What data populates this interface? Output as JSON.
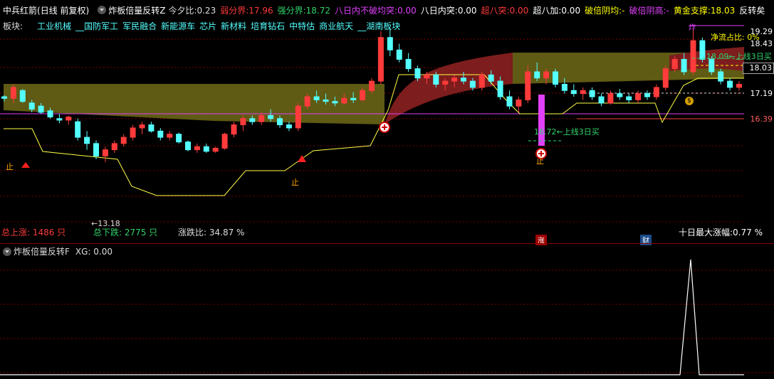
{
  "header": {
    "stock": "中兵红箭",
    "period": "(日线 前复权)",
    "indicator_name": "炸板倍量反转Z",
    "items": [
      {
        "label": "今夕比:",
        "value": "0.23",
        "label_color": "#dddddd",
        "value_color": "#dddddd"
      },
      {
        "label": "弱分界:",
        "value": "17.96",
        "label_color": "#ff3b3b",
        "value_color": "#ff3b3b"
      },
      {
        "label": "强分界:",
        "value": "18.72",
        "label_color": "#31d26a",
        "value_color": "#31d26a"
      },
      {
        "label": "八日内不破均突:",
        "value": "0.00",
        "label_color": "#e040fb",
        "value_color": "#e040fb"
      },
      {
        "label": "八日内突:",
        "value": "0.00",
        "label_color": "#ffffff",
        "value_color": "#ffffff"
      },
      {
        "label": "超八突:",
        "value": "0.00",
        "label_color": "#ff3b3b",
        "value_color": "#ff3b3b"
      },
      {
        "label": "超八加:",
        "value": "0.00",
        "label_color": "#ffffff",
        "value_color": "#ffffff"
      },
      {
        "label": "破倍阴均:",
        "value": "-",
        "label_color": "#ffff00",
        "value_color": "#ffff00"
      },
      {
        "label": "破倍阴高:",
        "value": "-",
        "label_color": "#e040fb",
        "value_color": "#e040fb"
      },
      {
        "label": "黄金支撑:",
        "value": "18.03",
        "label_color": "#ffff00",
        "value_color": "#ffff00"
      },
      {
        "label": "反转矣",
        "value": "",
        "label_color": "#ffffff",
        "value_color": "#ffffff"
      }
    ],
    "dropdown_icon": "chevron-down-icon"
  },
  "boards": {
    "label": "板块:",
    "items": [
      "工业机械",
      "__国防军工",
      "军民融合",
      "新能源车",
      "芯片",
      "新材料",
      "培育钻石",
      "中特估",
      "商业航天",
      "__湖南板块"
    ]
  },
  "price_scale": {
    "labels": [
      "19.29",
      "18.43",
      "18.03",
      "17.19",
      "16.39"
    ]
  },
  "annotations": {
    "low": "←13.18",
    "buy_line_1": "16.72←上线3日买",
    "buy_line_2": "18.09←上线3日买",
    "net_inflow": "净流占比: 0%",
    "flag_top": "炸",
    "stop_a": "止",
    "stop_b": "止",
    "stop_c": "止",
    "money_icon": "$"
  },
  "stats": {
    "total_up": "总上涨: 1486 只",
    "total_down": "总下跌: 2775 只",
    "ratio": "涨跌比: 34.87 %",
    "ten_day_max": "十日最大涨幅:0.77 %",
    "zhang_tag": "涨",
    "cai_tag": "财"
  },
  "subpanel": {
    "title": "炸板倍量反转F",
    "xg_label": "XG: 0.00"
  },
  "colors": {
    "up": "#ff3b3b",
    "down": "#54ffff",
    "band_olive": "#5f5a14",
    "band_red": "#7d1d1d",
    "yellow_line": "#ffff44",
    "magenta": "#e040fb",
    "grid": "#7a0000"
  },
  "chart_data": {
    "type": "candlestick",
    "candles": [
      [
        17.1,
        17.15,
        16.95,
        17.05
      ],
      [
        17.05,
        17.5,
        16.9,
        17.4
      ],
      [
        17.3,
        17.35,
        16.9,
        16.95
      ],
      [
        16.9,
        17.0,
        16.6,
        16.7
      ],
      [
        16.8,
        16.9,
        16.55,
        16.6
      ],
      [
        16.65,
        16.75,
        16.4,
        16.45
      ],
      [
        16.4,
        16.55,
        16.25,
        16.35
      ],
      [
        16.35,
        16.5,
        16.2,
        16.45
      ],
      [
        16.3,
        16.4,
        15.7,
        15.8
      ],
      [
        15.8,
        16.0,
        15.4,
        15.6
      ],
      [
        15.6,
        15.7,
        15.1,
        15.2
      ],
      [
        15.2,
        15.5,
        15.0,
        15.4
      ],
      [
        15.4,
        15.7,
        15.3,
        15.6
      ],
      [
        15.6,
        15.9,
        15.5,
        15.8
      ],
      [
        15.8,
        16.2,
        15.7,
        16.1
      ],
      [
        16.1,
        16.3,
        15.9,
        16.2
      ],
      [
        16.2,
        16.3,
        15.95,
        16.0
      ],
      [
        16.0,
        16.1,
        15.7,
        15.8
      ],
      [
        15.8,
        16.0,
        15.7,
        15.9
      ],
      [
        15.9,
        15.95,
        15.6,
        15.65
      ],
      [
        15.65,
        15.7,
        15.35,
        15.4
      ],
      [
        15.4,
        15.6,
        15.3,
        15.5
      ],
      [
        15.5,
        15.6,
        15.3,
        15.35
      ],
      [
        15.35,
        15.5,
        15.3,
        15.45
      ],
      [
        15.45,
        15.95,
        15.4,
        15.9
      ],
      [
        15.9,
        16.3,
        15.8,
        16.2
      ],
      [
        16.2,
        16.5,
        16.0,
        16.4
      ],
      [
        16.4,
        16.5,
        16.2,
        16.3
      ],
      [
        16.3,
        16.6,
        16.2,
        16.5
      ],
      [
        16.5,
        16.7,
        16.3,
        16.4
      ],
      [
        16.4,
        16.5,
        16.1,
        16.2
      ],
      [
        16.2,
        16.3,
        16.0,
        16.1
      ],
      [
        16.1,
        16.9,
        16.0,
        16.8
      ],
      [
        16.8,
        17.2,
        16.7,
        17.1
      ],
      [
        17.1,
        17.3,
        16.9,
        17.0
      ],
      [
        17.0,
        17.2,
        16.85,
        16.95
      ],
      [
        16.95,
        17.1,
        16.8,
        16.9
      ],
      [
        16.9,
        17.2,
        16.85,
        17.05
      ],
      [
        17.05,
        17.25,
        16.9,
        17.0
      ],
      [
        17.0,
        17.4,
        16.95,
        17.3
      ],
      [
        17.3,
        17.7,
        17.2,
        17.6
      ],
      [
        17.6,
        19.2,
        17.5,
        19.0
      ],
      [
        19.0,
        19.3,
        18.4,
        18.6
      ],
      [
        18.6,
        18.8,
        18.2,
        18.3
      ],
      [
        18.3,
        18.5,
        17.9,
        18.0
      ],
      [
        18.0,
        18.1,
        17.6,
        17.7
      ],
      [
        17.7,
        17.9,
        17.5,
        17.8
      ],
      [
        17.8,
        17.9,
        17.4,
        17.5
      ],
      [
        17.5,
        17.7,
        17.3,
        17.6
      ],
      [
        17.6,
        17.8,
        17.4,
        17.7
      ],
      [
        17.7,
        17.9,
        17.5,
        17.6
      ],
      [
        17.6,
        17.7,
        17.3,
        17.4
      ],
      [
        17.4,
        17.9,
        17.3,
        17.8
      ],
      [
        17.8,
        17.95,
        17.5,
        17.6
      ],
      [
        17.6,
        17.75,
        17.0,
        17.1
      ],
      [
        17.1,
        17.3,
        16.7,
        16.8
      ],
      [
        16.8,
        17.1,
        16.6,
        17.0
      ],
      [
        17.0,
        18.1,
        16.9,
        17.9
      ],
      [
        17.9,
        18.2,
        17.6,
        17.7
      ],
      [
        17.7,
        18.0,
        17.5,
        17.9
      ],
      [
        17.9,
        18.0,
        17.4,
        17.5
      ],
      [
        17.5,
        17.7,
        17.2,
        17.3
      ],
      [
        17.3,
        17.5,
        17.1,
        17.2
      ],
      [
        17.2,
        17.4,
        17.0,
        17.3
      ],
      [
        17.3,
        17.4,
        17.0,
        17.1
      ],
      [
        17.1,
        17.2,
        16.8,
        16.9
      ],
      [
        16.9,
        17.3,
        16.85,
        17.2
      ],
      [
        17.2,
        17.35,
        17.0,
        17.1
      ],
      [
        17.1,
        17.2,
        16.9,
        17.0
      ],
      [
        17.0,
        17.3,
        16.9,
        17.2
      ],
      [
        17.2,
        17.3,
        17.0,
        17.1
      ],
      [
        17.1,
        17.5,
        17.0,
        17.4
      ],
      [
        17.4,
        18.1,
        17.3,
        18.0
      ],
      [
        18.0,
        18.4,
        17.9,
        18.3
      ],
      [
        18.3,
        18.5,
        17.8,
        17.9
      ],
      [
        17.9,
        19.3,
        17.8,
        18.9
      ],
      [
        18.9,
        19.0,
        18.2,
        18.3
      ],
      [
        18.3,
        18.4,
        17.8,
        17.9
      ],
      [
        17.9,
        18.0,
        17.5,
        17.6
      ],
      [
        17.6,
        17.7,
        17.3,
        17.4
      ],
      [
        17.4,
        17.6,
        17.3,
        17.5
      ]
    ]
  }
}
